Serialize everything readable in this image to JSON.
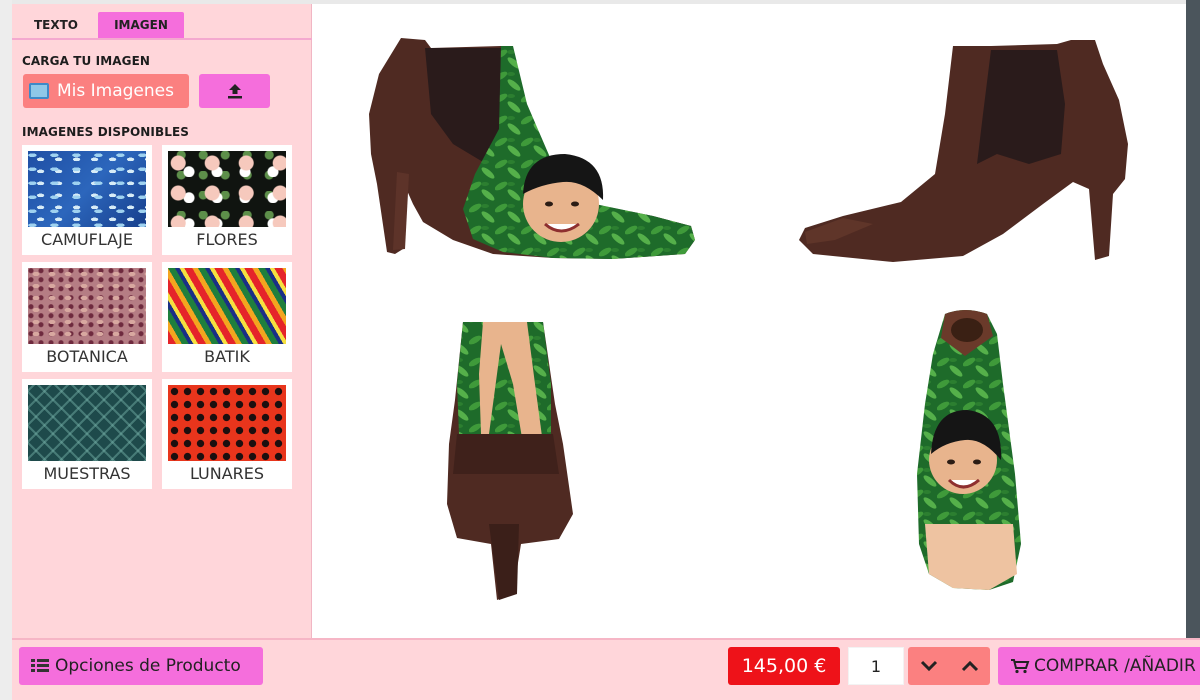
{
  "tabs": {
    "texto": "TEXTO",
    "imagen": "IMAGEN"
  },
  "upload_section": {
    "title": "CARGA TU IMAGEN",
    "my_images_button": "Mis Imagenes"
  },
  "available_section": {
    "title": "IMAGENES DISPONIBLES",
    "patterns": [
      {
        "label": "CAMUFLAJE"
      },
      {
        "label": "FLORES"
      },
      {
        "label": "BOTANICA"
      },
      {
        "label": "BATIK"
      },
      {
        "label": "MUESTRAS"
      },
      {
        "label": "LUNARES"
      }
    ]
  },
  "bottom_bar": {
    "options_button": "Opciones de Producto",
    "price": "145,00 €",
    "quantity": "1",
    "buy_button": "COMPRAR /AÑADIR"
  },
  "colors": {
    "panel_bg": "#ffd6da",
    "accent_pink": "#f56edc",
    "salmon": "#fb8080",
    "price_red": "#ee1219"
  }
}
